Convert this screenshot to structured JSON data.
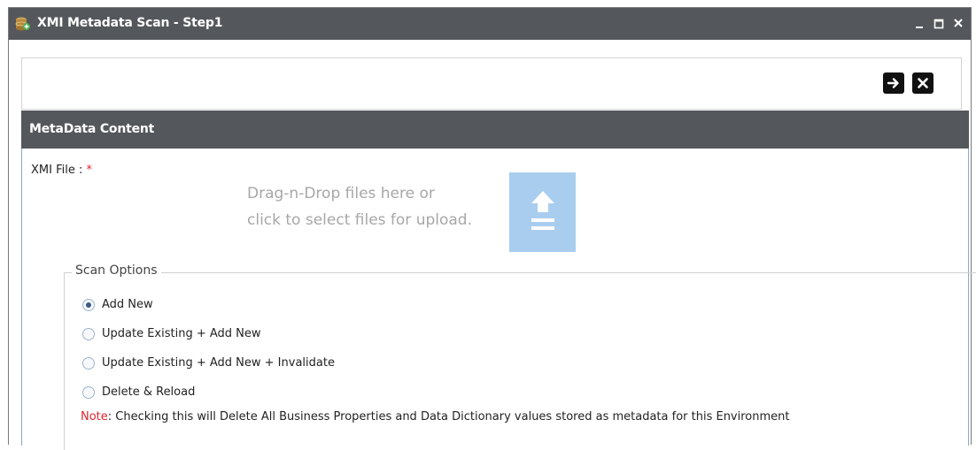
{
  "window": {
    "title": "XMI Metadata Scan - Step1",
    "controls": {
      "minimize": "_",
      "maximize": "□",
      "close": "✕"
    }
  },
  "section": {
    "title": "MetaData Content"
  },
  "form": {
    "xmi_file_label": "XMI File : ",
    "required_mark": "*",
    "dropzone_line1": "Drag-n-Drop files here or",
    "dropzone_line2": "click to select files for upload."
  },
  "scan_options": {
    "legend": "Scan Options",
    "options": [
      {
        "label": "Add New",
        "checked": true
      },
      {
        "label": "Update Existing + Add New",
        "checked": false
      },
      {
        "label": "Update Existing + Add New + Invalidate",
        "checked": false
      },
      {
        "label": "Delete & Reload",
        "checked": false
      }
    ],
    "note_label": "Note",
    "note_text": ": Checking this will Delete All Business Properties and Data Dictionary values stored as metadata for this Environment"
  },
  "colors": {
    "titlebar": "#54575b",
    "upload_box": "#a9cdee",
    "required": "#e0252b"
  }
}
